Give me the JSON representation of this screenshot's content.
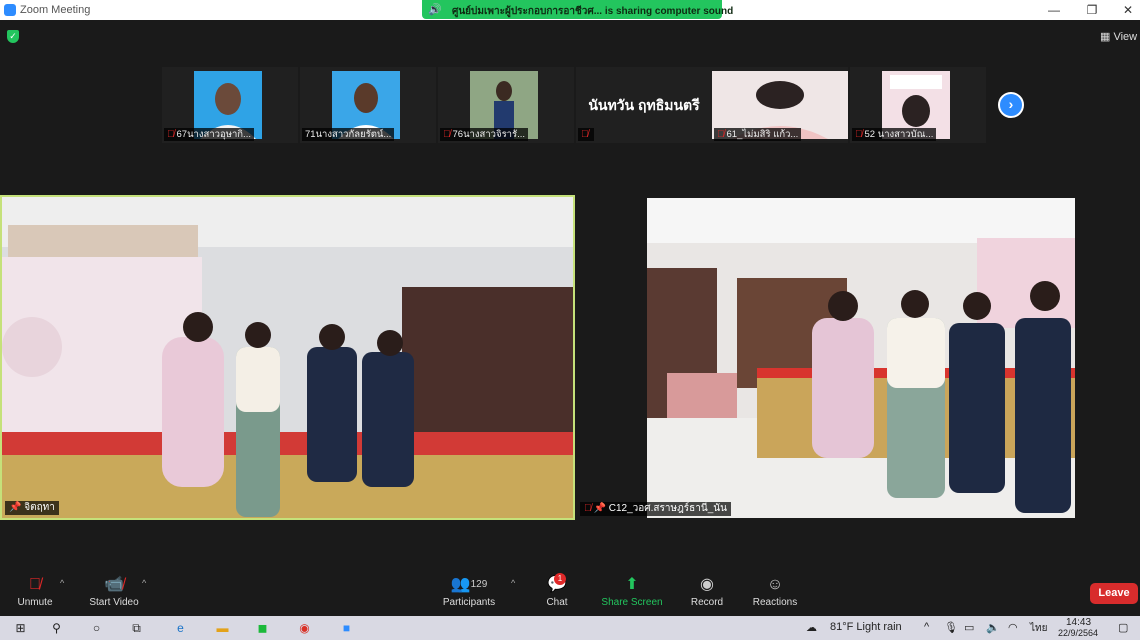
{
  "window": {
    "title": "Zoom Meeting",
    "minimize": "—",
    "restore": "❐",
    "close": "✕"
  },
  "share_banner": "ศูนย์บ่มเพาะผู้ประกอบการอาชีวศ... is sharing computer sound",
  "view_label": "View",
  "gallery": [
    {
      "label": "67นางสาวอุษากิ..."
    },
    {
      "label": "71นางสาวกัลยรัตน์..."
    },
    {
      "label": "76นางสาวจิรารั..."
    },
    {
      "name": "นันทวัน ฤทธิมนตรี"
    },
    {
      "label": "61_ไม่มสิริ แก้ว..."
    },
    {
      "label": "52 นางสาวบัณ..."
    }
  ],
  "videos": {
    "main_label": "จิตฤทา",
    "side_label": "C12_วอศ.สราษฎร์ธานี_นัน"
  },
  "toolbar": {
    "unmute": "Unmute",
    "start_video": "Start Video",
    "participants": "Participants",
    "participants_count": "129",
    "chat": "Chat",
    "chat_badge": "1",
    "share_screen": "Share Screen",
    "record": "Record",
    "reactions": "Reactions",
    "leave": "Leave"
  },
  "taskbar": {
    "weather": "81°F  Light rain",
    "lang": "ไทย",
    "time": "14:43",
    "date": "22/9/2564"
  },
  "colors": {
    "accent": "#2d8cff",
    "share_green": "#23c55e",
    "leave_red": "#d82c2c",
    "active_speaker": "#c5e17a"
  }
}
